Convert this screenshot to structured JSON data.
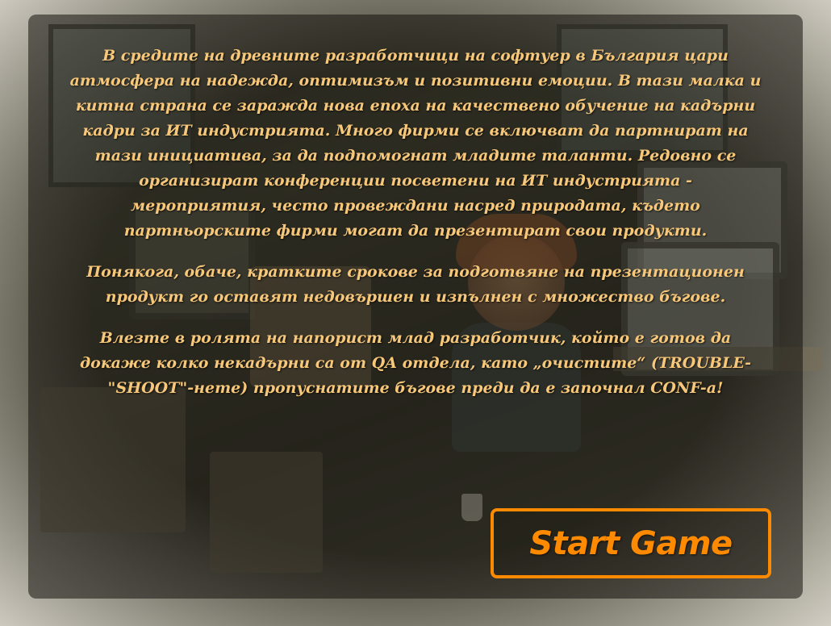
{
  "story": {
    "paragraph_1": "В средите на древните разработчици на софтуер в България цари атмосфера на надежда, оптимизъм и позитивни емоции. В тази малка и китна страна се заражда нова епоха на качествено обучение на кадърни кадри за ИТ индустрията. Много фирми се включват да партнират на тази инициатива, за да подпомогнат младите таланти. Редовно се организират конференции посветени на ИТ индустрията - мероприятия, често провеждани насред природата, където партньорските фирми могат да презентират свои продукти.",
    "paragraph_2": "Понякога, обаче, кратките срокове за подготвяне на презентационен продукт го оставят недовършен и изпълнен с множество бъгове.",
    "paragraph_3": "Влезте в ролята на напорист млад разработчик, който е готов да докаже колко некадърни са от QA отдела, като „очистите“ (TROUBLE-\"SHOOT\"-нете) пропуснатите бъгове преди да е започнал CONF-а!"
  },
  "start_button": {
    "label": "Start Game"
  },
  "colors": {
    "story_text": "#f7c77a",
    "button_accent": "#ff8a00",
    "panel_overlay": "rgba(20,18,12,0.55)"
  }
}
